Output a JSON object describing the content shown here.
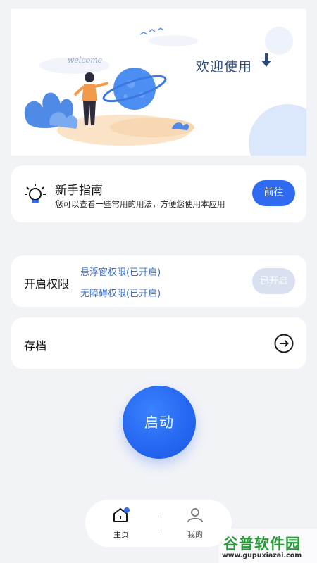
{
  "banner": {
    "welcome_title": "欢迎使用",
    "illustration_caption": "welcome"
  },
  "guide_card": {
    "title": "新手指南",
    "description": "您可以查看一些常用的用法，方便您使用本应用",
    "goto_label": "前往"
  },
  "permissions_card": {
    "title": "开启权限",
    "items": [
      "悬浮窗权限(已开启)",
      "无障碍权限(已开启)"
    ],
    "status_label": "已开启"
  },
  "archive_card": {
    "title": "存档"
  },
  "start_button": {
    "label": "启动"
  },
  "bottom_nav": {
    "items": [
      {
        "label": "主页",
        "icon": "home-icon",
        "active": true
      },
      {
        "label": "我的",
        "icon": "person-icon",
        "active": false
      }
    ]
  },
  "watermark": {
    "title": "谷普软件园",
    "url": "www.gupuxiazai.com"
  },
  "colors": {
    "accent": "#2f6bf0",
    "permission_text": "#3d6fc4",
    "disabled_button": "#d9e0f0",
    "background": "#f2f3f7"
  }
}
